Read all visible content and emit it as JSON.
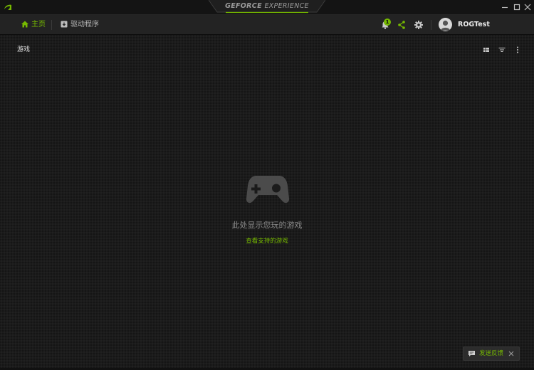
{
  "window": {
    "title_bold": "GEFORCE",
    "title_light": "EXPERIENCE"
  },
  "nav": {
    "home_label": "主页",
    "drivers_label": "驱动程序"
  },
  "header": {
    "notification_count": "1",
    "username": "ROGTest"
  },
  "games": {
    "section_title": "游戏",
    "empty_message": "此处显示您玩的游戏",
    "supported_link": "查看支持的游戏"
  },
  "feedback": {
    "label": "发送反馈"
  },
  "colors": {
    "accent": "#76b900",
    "background": "#1b1b1b"
  },
  "icons": [
    "nvidia-logo",
    "home-icon",
    "drivers-icon",
    "bell-icon",
    "share-icon",
    "gear-icon",
    "grid-view-icon",
    "filter-icon",
    "more-icon",
    "gamepad-icon",
    "chat-icon",
    "close-icon"
  ]
}
